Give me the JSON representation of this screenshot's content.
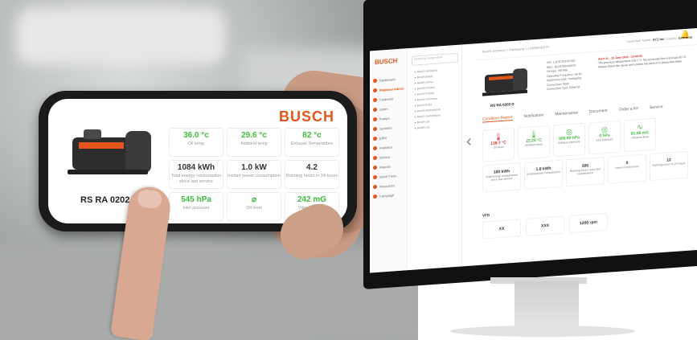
{
  "phone": {
    "brand": "BUSCH",
    "model": "RS RA 0202 D",
    "tiles": [
      {
        "value": "36.0 °c",
        "label": "Oil temp",
        "green": true
      },
      {
        "value": "29.6 °c",
        "label": "Ambient temp",
        "green": true
      },
      {
        "value": "82 °c",
        "label": "Exhaust Temperature",
        "green": true
      },
      {
        "value": "1084 kWh",
        "label": "Total energy consumption since last service",
        "green": false
      },
      {
        "value": "1.0 kW",
        "label": "Instant power consumption",
        "green": false
      },
      {
        "value": "4.2",
        "label": "Running hours in 24 hours",
        "green": false
      },
      {
        "value": "545 hPa",
        "label": "Inlet pressure",
        "green": true
      },
      {
        "value": "",
        "label": "Oil level",
        "green": true
      },
      {
        "value": "242 mG",
        "label": "Vibration level",
        "green": true
      }
    ]
  },
  "desktop": {
    "brand": "BUSCH",
    "nav": [
      "Dashboard",
      "Regional Admin",
      "Customer",
      "Users",
      "Pumps",
      "Systems",
      "ERM",
      "Analytics",
      "Service",
      "Reports",
      "Quick Fixes",
      "Resources",
      "Campaign"
    ],
    "active_nav": "Regional Admin",
    "tree": [
      "Search by pump name",
      "Busch Simulator",
      "Busch Brazil",
      "Busch China",
      "Busch Finland",
      "Busch France",
      "Busch Germany",
      "Busch India",
      "Busch Netherlands",
      "Busch Switzerland",
      "Busch UK",
      "Busch US"
    ],
    "search_placeholder": "Search by pump name",
    "breadcrumb": "Busch Germany > Packaging > 1340EF0DE7F",
    "customer_label": "Customer Name:",
    "customer": "XYZ Inc",
    "country_label": "Country:",
    "country": "Germany",
    "model": "RS RA 0202 D",
    "info": [
      "S/N: C1E871BF9F398",
      "MAC: 80C87B9049024",
      "Oil type: VM 068",
      "Operating Frequency: 60 Hz",
      "Application type: Packaging",
      "Connection: Open",
      "Connection Type: Ethernet"
    ],
    "alert_title": "Alert #1 · 15 June 2022 · 10:40:00",
    "alert_text": "The pressure temperature 110.2 °C has exceeded the maximum 80 °C. Please check the cause and contact the service or production team.",
    "tabs": [
      "Condition Report",
      "Notification",
      "Maintenance",
      "Document",
      "Order a Kit",
      "Service"
    ],
    "active_tab": "Condition Report",
    "cards": [
      {
        "icon": "🌡",
        "value": "136.7 °C",
        "label": "Oil temp",
        "color": "#d0281e"
      },
      {
        "icon": "🌡",
        "value": "22.20 °C",
        "label": "Ambient temp",
        "color": "#3dba3b"
      },
      {
        "icon": "◎",
        "value": "998.88 hPa",
        "label": "Exhaust pressure",
        "color": "#3dba3b"
      },
      {
        "icon": "◎",
        "value": "0 hPa",
        "label": "Inlet pressure",
        "color": "#3dba3b"
      },
      {
        "icon": "∿",
        "value": "61.86 mG",
        "label": "Vibration level",
        "color": "#3dba3b"
      }
    ],
    "cards2": [
      {
        "value": "160 kWh",
        "label": "Total energy consumption since last service"
      },
      {
        "value": "1.8 kWh",
        "label": "Instant power consumption"
      },
      {
        "value": "590",
        "label": "Running hours since last maintenance"
      },
      {
        "value": "0",
        "label": "Hours to next Fixer"
      },
      {
        "value": "12",
        "label": "Running hours in 24 hours"
      }
    ],
    "section": "VFD",
    "cards3": [
      "XX",
      "XXX",
      "1200 rpm"
    ]
  }
}
